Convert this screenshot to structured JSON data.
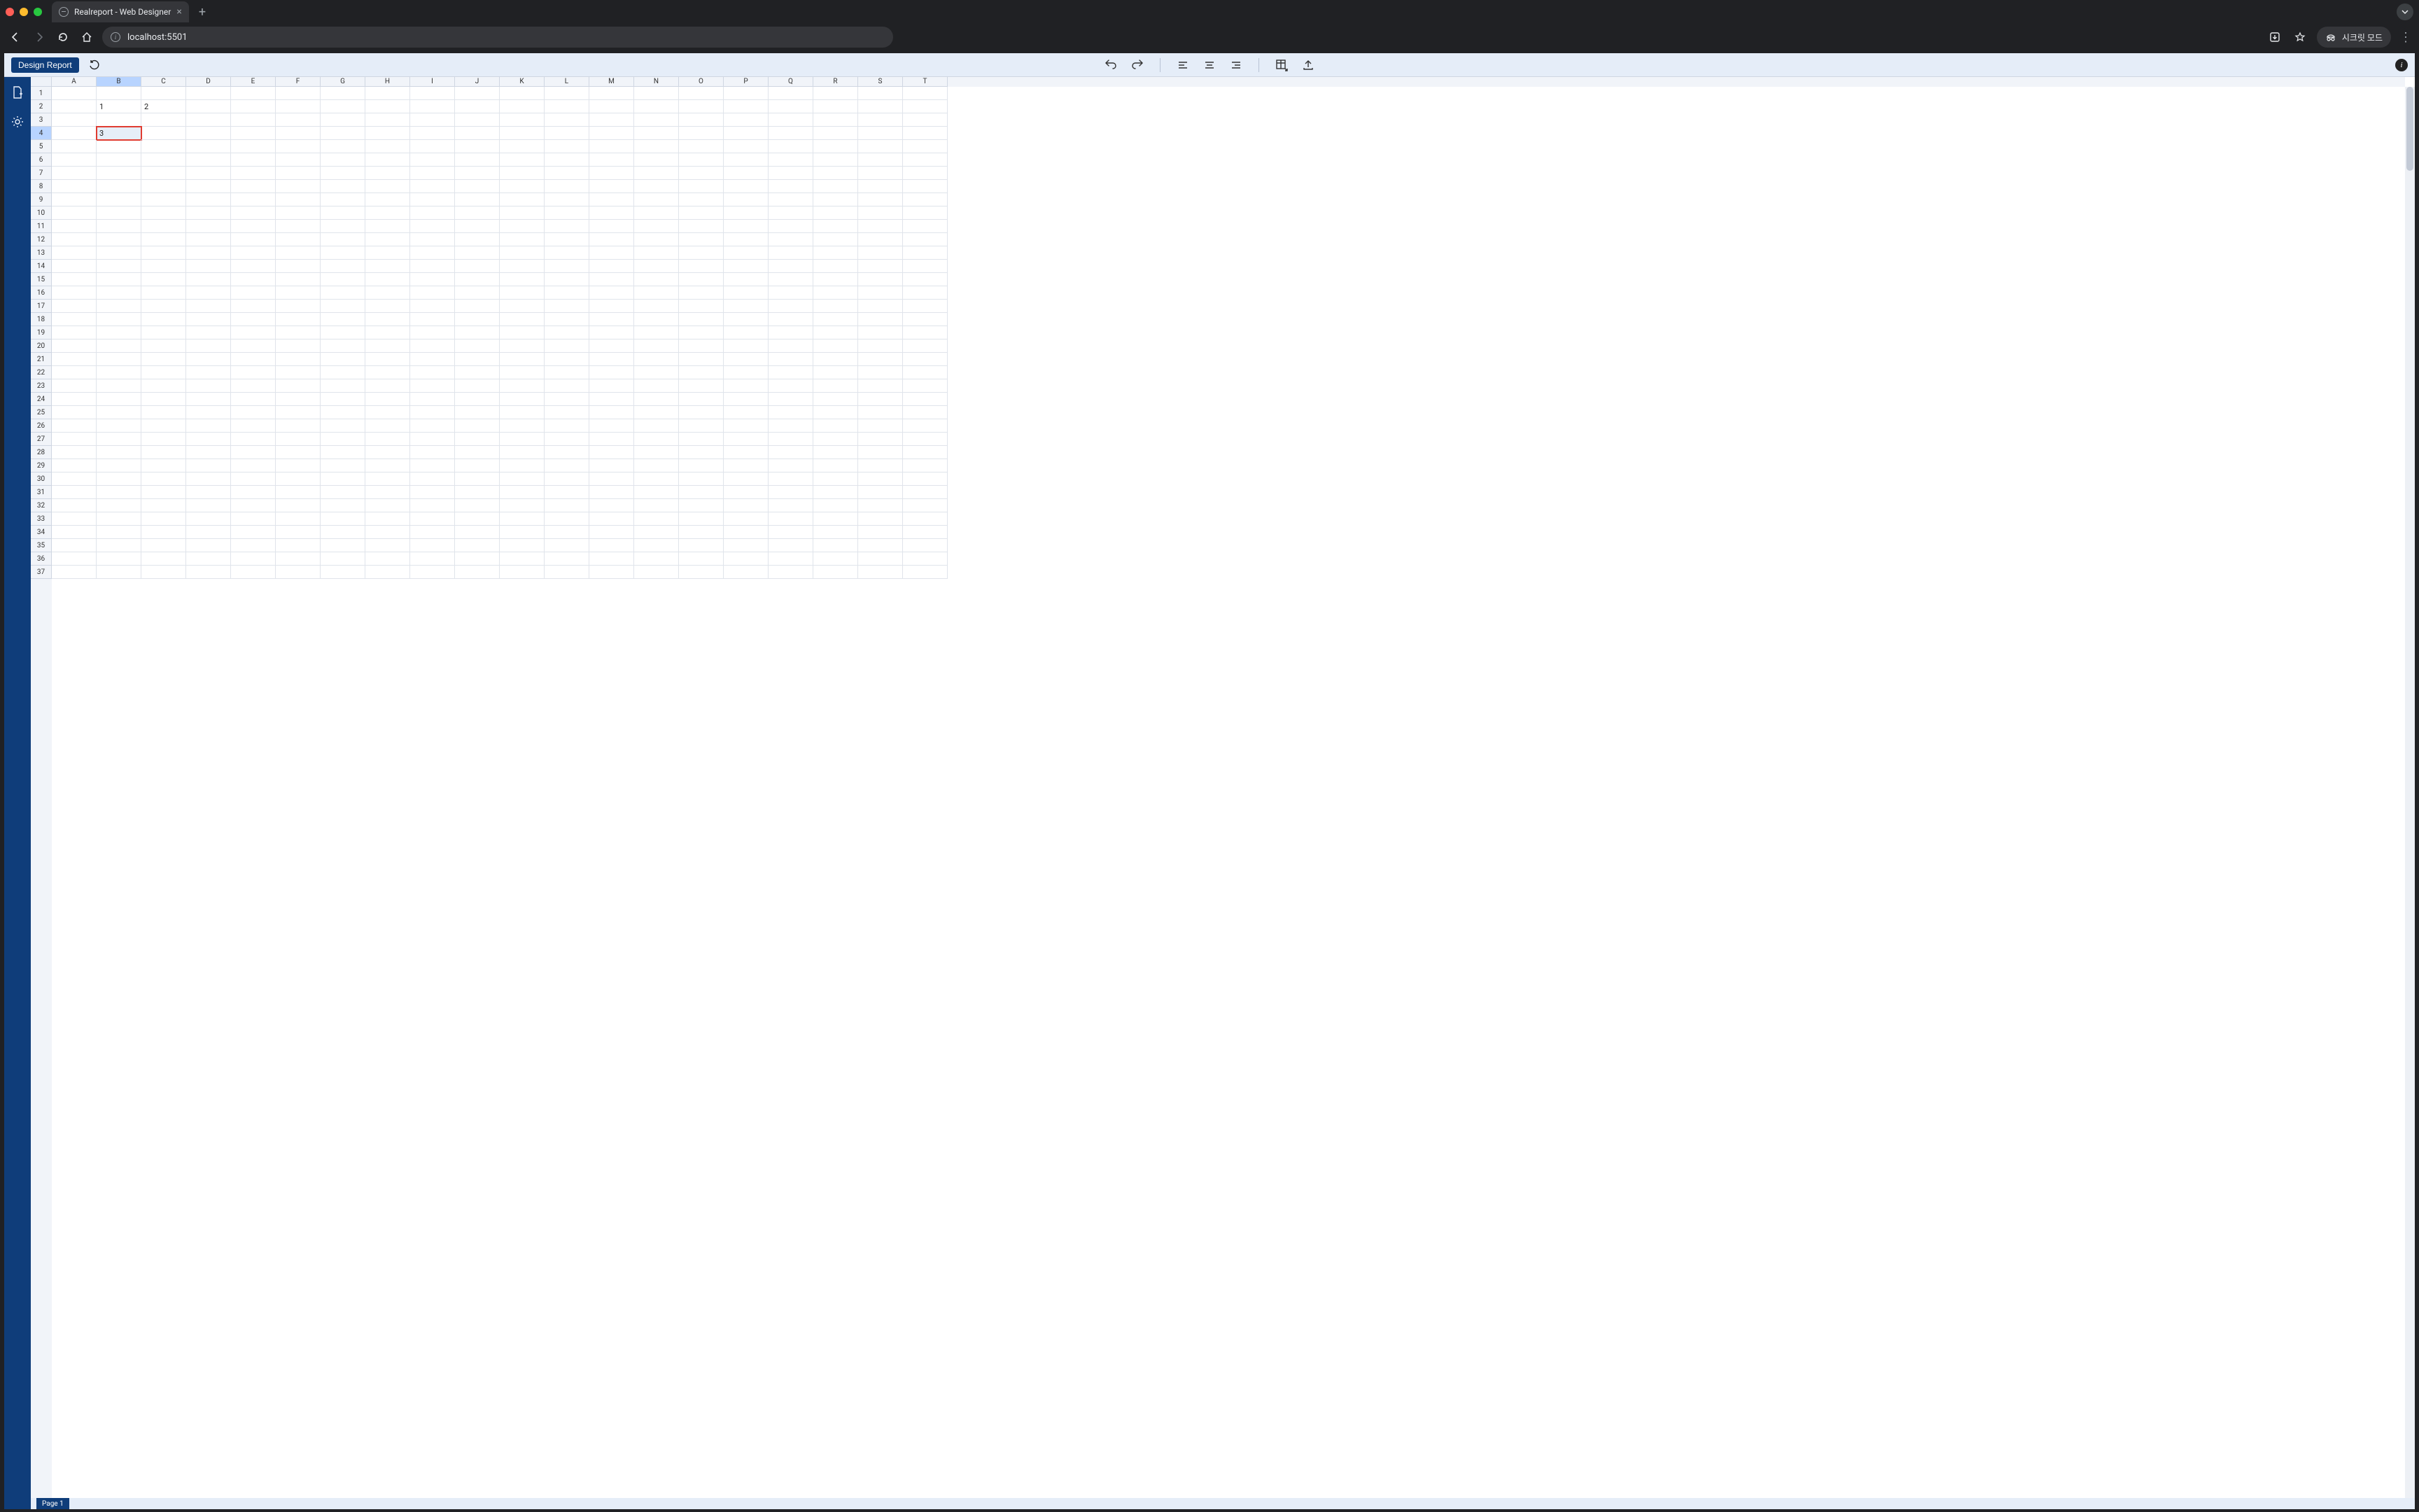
{
  "browser": {
    "tab_title": "Realreport - Web Designer",
    "url": "localhost:5501",
    "incognito_label": "시크릿 모드"
  },
  "toolbar": {
    "design_report_label": "Design Report"
  },
  "sheet": {
    "columns": [
      "A",
      "B",
      "C",
      "D",
      "E",
      "F",
      "G",
      "H",
      "I",
      "J",
      "K",
      "L",
      "M",
      "N",
      "O",
      "P",
      "Q",
      "R",
      "S",
      "T"
    ],
    "row_count": 37,
    "selected_col": "B",
    "selected_row": 4,
    "cells": {
      "B2": "1",
      "C2": "2",
      "B4": "3"
    },
    "active_cell": "B4",
    "page_tab": "Page 1"
  }
}
